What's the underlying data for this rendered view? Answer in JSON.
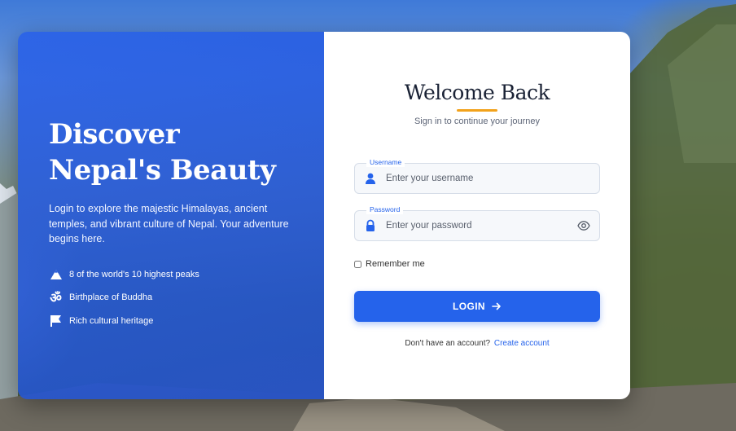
{
  "hero": {
    "title": "Discover Nepal's Beauty",
    "description": "Login to explore the majestic Himalayas, ancient temples, and vibrant culture of Nepal. Your adventure begins here.",
    "features": [
      {
        "icon": "mountain-icon",
        "label": "8 of the world's 10 highest peaks"
      },
      {
        "icon": "om-icon",
        "label": "Birthplace of Buddha"
      },
      {
        "icon": "flag-icon",
        "label": "Rich cultural heritage"
      }
    ]
  },
  "form": {
    "title": "Welcome Back",
    "subtitle": "Sign in to continue your journey",
    "username": {
      "label": "Username",
      "placeholder": "Enter your username",
      "value": ""
    },
    "password": {
      "label": "Password",
      "placeholder": "Enter your password",
      "value": ""
    },
    "remember_label": "Remember me",
    "login_label": "LOGIN",
    "signup_prompt": "Don't have an account?",
    "signup_link": "Create account"
  },
  "colors": {
    "accent": "#2563eb",
    "underline": "#f2a21b",
    "hero_panel": "#2860e8"
  }
}
